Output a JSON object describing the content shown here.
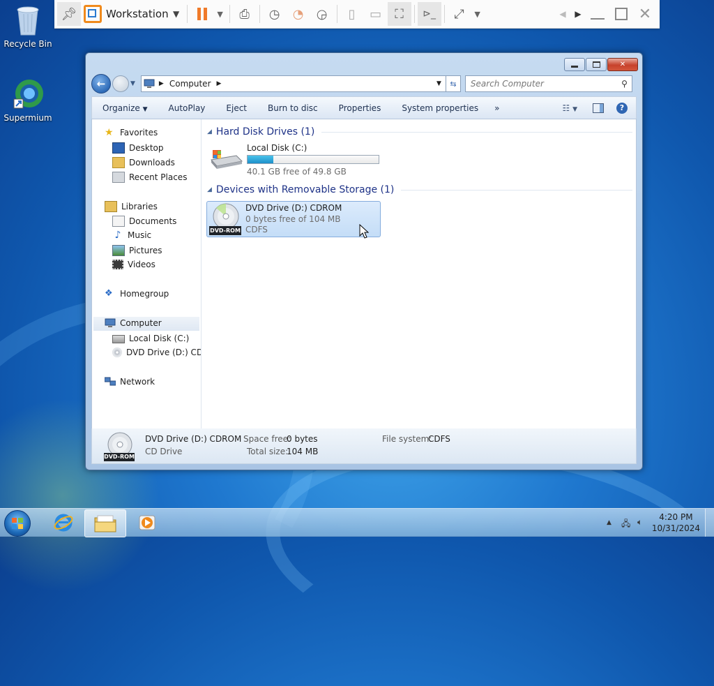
{
  "desktop": {
    "icons": [
      {
        "label": "Recycle Bin"
      },
      {
        "label": "Supermium"
      }
    ]
  },
  "vm_toolbar": {
    "title": "Workstation"
  },
  "explorer": {
    "address": {
      "segments": [
        "Computer"
      ]
    },
    "search": {
      "placeholder": "Search Computer"
    },
    "commands": [
      "Organize",
      "AutoPlay",
      "Eject",
      "Burn to disc",
      "Properties",
      "System properties"
    ],
    "commands_more": "»",
    "nav": {
      "favorites": {
        "label": "Favorites",
        "items": [
          "Desktop",
          "Downloads",
          "Recent Places"
        ]
      },
      "libraries": {
        "label": "Libraries",
        "items": [
          "Documents",
          "Music",
          "Pictures",
          "Videos"
        ]
      },
      "homegroup": "Homegroup",
      "computer": {
        "label": "Computer",
        "items": [
          "Local Disk (C:)",
          "DVD Drive (D:) CDRO"
        ]
      },
      "network": "Network"
    },
    "groups": {
      "hdd": {
        "title": "Hard Disk Drives (1)",
        "drive": {
          "name": "Local Disk (C:)",
          "free_text": "40.1 GB free of 49.8 GB",
          "used_fraction": 0.195
        }
      },
      "removable": {
        "title": "Devices with Removable Storage (1)",
        "drive": {
          "name": "DVD Drive (D:) CDROM",
          "free_text": "0 bytes free of 104 MB",
          "fs": "CDFS",
          "badge": "DVD-ROM"
        }
      }
    },
    "details": {
      "name": "DVD Drive (D:) CDROM",
      "type": "CD Drive",
      "space_free_label": "Space free:",
      "space_free": "0 bytes",
      "total_size_label": "Total size:",
      "total_size": "104 MB",
      "fs_label": "File system:",
      "fs": "CDFS",
      "badge": "DVD-ROM"
    }
  },
  "taskbar": {
    "time": "4:20 PM",
    "date": "10/31/2024"
  },
  "colors": {
    "accent": "#1f78cf",
    "window_frame": "#b3cce8",
    "group_title": "#1e3287"
  }
}
